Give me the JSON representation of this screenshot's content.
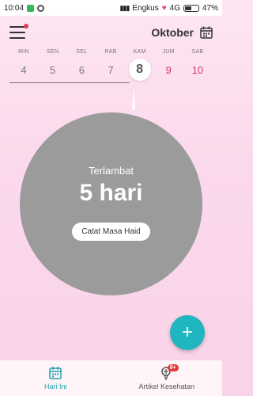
{
  "status_bar": {
    "time": "10:04",
    "carrier": "Engkus",
    "network": "4G",
    "battery": "47%"
  },
  "header": {
    "month": "Oktober",
    "menu_icon": "hamburger-menu-icon",
    "calendar_icon": "calendar-icon"
  },
  "week": [
    {
      "name": "MIN",
      "num": "4",
      "state": "past"
    },
    {
      "name": "SEN",
      "num": "5",
      "state": "past"
    },
    {
      "name": "SEL",
      "num": "6",
      "state": "past"
    },
    {
      "name": "RAB",
      "num": "7",
      "state": "past"
    },
    {
      "name": "KAM",
      "num": "8",
      "state": "today"
    },
    {
      "name": "JUM",
      "num": "9",
      "state": "future"
    },
    {
      "name": "SAB",
      "num": "10",
      "state": "future"
    }
  ],
  "main": {
    "status_label": "Terlambat",
    "days_value": "5 hari",
    "log_button": "Catat Masa Haid"
  },
  "fab": {
    "label": "+"
  },
  "bottom_nav": {
    "today_label": "Hari Ini",
    "articles_label": "Artikel Kesehatan",
    "articles_badge": "9+"
  },
  "colors": {
    "accent": "#1fb6bf",
    "circle": "#9b9b9b",
    "future_day": "#d4395e"
  }
}
